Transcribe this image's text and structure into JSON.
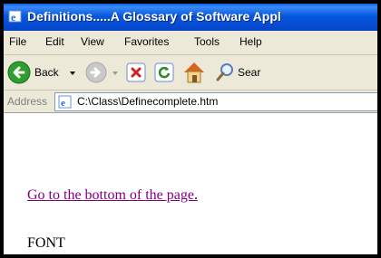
{
  "window": {
    "title": "Definitions.....A Glossary of Software Appl"
  },
  "menu": {
    "items": [
      "File",
      "Edit",
      "View",
      "Favorites",
      "Tools",
      "Help"
    ]
  },
  "toolbar": {
    "back_label": "Back",
    "search_label": "Sear"
  },
  "address": {
    "label": "Address",
    "value": "C:\\Class\\Definecomplete.htm"
  },
  "content": {
    "link_text": "Go to the bottom of the page",
    "link_suffix": ".",
    "heading": "FONT"
  },
  "colors": {
    "link_visited": "#800080",
    "titlebar": "#0758e0",
    "chrome": "#ece9d8"
  }
}
